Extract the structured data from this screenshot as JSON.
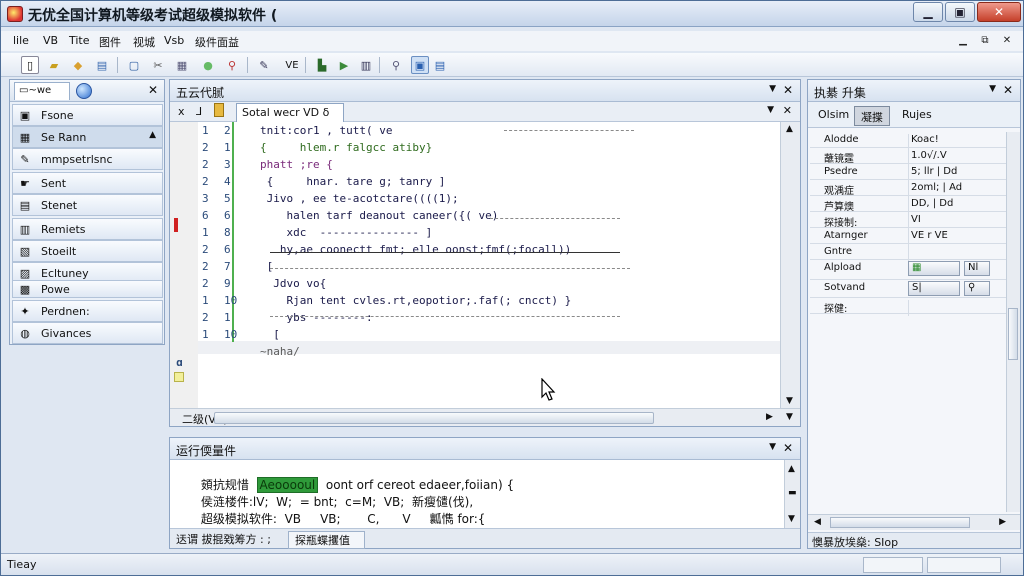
{
  "title_bar": {
    "title": "无优全国计算机等级考试超级模拟软件 (",
    "minimize": "▁",
    "maximize": "▣",
    "close": "✕"
  },
  "menu": {
    "items": [
      "lile",
      "VB",
      "Tite",
      "图件",
      "视城",
      "Vsb",
      "级件面益"
    ],
    "mdi_min": "▁",
    "mdi_restore": "⧉",
    "mdi_close": "✕"
  },
  "left_panel": {
    "tab_label": "~we",
    "items": [
      {
        "icon": "folder-icon",
        "label": "Fsone",
        "glyph": "▣"
      },
      {
        "icon": "grid-icon",
        "label": "Se Rann",
        "glyph": "▦",
        "caret": "▲"
      },
      {
        "icon": "tool-icon",
        "label": "mmpsetrlsnc",
        "glyph": "✎"
      },
      {
        "icon": "hand-icon",
        "label": "Sent",
        "glyph": "☛"
      },
      {
        "icon": "document-icon",
        "label": "Stenet",
        "glyph": "▤"
      },
      {
        "icon": "page-icon",
        "label": "Remiets",
        "glyph": "▥"
      },
      {
        "icon": "book-icon",
        "label": "Stoeilt",
        "glyph": "▧"
      },
      {
        "icon": "layout-icon",
        "label": "Ecltuney",
        "glyph": "▨"
      },
      {
        "icon": "power-icon",
        "label": "Powe",
        "glyph": "▩"
      },
      {
        "icon": "wrench-icon",
        "label": "Perdnen:",
        "glyph": "✦"
      },
      {
        "icon": "globe-icon",
        "label": "Givances",
        "glyph": "◍"
      }
    ]
  },
  "editor": {
    "panel_title": "五云代腻",
    "doc_tab": "Sotal wecr VD",
    "doc_tab_mark": "δ",
    "gutter_marks": [
      "x",
      "⅃",
      "ɑ"
    ],
    "lines": [
      {
        "a": "1",
        "b": "2",
        "text": "tnit:cor1 , tutt( ve",
        "cls": ""
      },
      {
        "a": "2",
        "b": "1",
        "text": "{     hlem.r falgcc atiby}",
        "cls": "fn"
      },
      {
        "a": "2",
        "b": "3",
        "text": "phatt ;re {",
        "cls": "kw"
      },
      {
        "a": "2",
        "b": "4",
        "text": " {     hnar. tare g; tanry ]",
        "cls": ""
      },
      {
        "a": "3",
        "b": "5",
        "text": " Jivo , ee te-acotctare((((1);",
        "cls": ""
      },
      {
        "a": "6",
        "b": "6",
        "text": "    halen tarf deanout caneer({( ve)",
        "cls": ""
      },
      {
        "a": "1",
        "b": "8",
        "text": "    xdc  --------------- ]",
        "cls": ""
      },
      {
        "a": "2",
        "b": "6",
        "text": "   hy,ae coonectt fmt; elle oonst;fmf(;focall))",
        "cls": ""
      },
      {
        "a": "2",
        "b": "7",
        "text": " [",
        "cls": ""
      },
      {
        "a": "2",
        "b": "9",
        "text": "  Jdvo vo{",
        "cls": ""
      },
      {
        "a": "1",
        "b": "10",
        "text": "    Rjan tent cvles.rt,eopotior;.faf(; cncct) }",
        "cls": ""
      },
      {
        "a": "2",
        "b": "1",
        "text": "    ybs --------:",
        "cls": ""
      },
      {
        "a": "1",
        "b": "10",
        "text": "  [",
        "cls": ""
      },
      {
        "a": "",
        "b": "",
        "text": "~naha/",
        "cls": "dim"
      }
    ],
    "bottom_label": "二级(VB)"
  },
  "output": {
    "title": "运行偄量件",
    "lines": [
      {
        "prefix": "頞抗规惜",
        "highlight": "Aeooooul",
        "rest": "  oont orf cereot edaeer,foiian) {"
      },
      {
        "prefix": "侯涟楼件:lV;",
        "highlight": "",
        "rest": "  W;  = bnt;  c=M;  VB;  新瘦儙(伐),"
      },
      {
        "prefix": "超级模拟软件:",
        "highlight": "",
        "rest": "  VB     VB;       C,      V     瓤懏 for:{"
      }
    ],
    "tabs": [
      "迗谓 拔掍戣筹方 : ;",
      "探瓶蝶攫值"
    ]
  },
  "properties": {
    "title": "执綦 升集",
    "tabs": [
      "Olsim",
      "凝揲",
      "Rujes"
    ],
    "rows": [
      {
        "key": "Alodde",
        "value": "Koac!"
      },
      {
        "key": "蘸镜霆",
        "value": "1.0√/.V"
      },
      {
        "key": "Psedre",
        "value": "5; llr | Dd"
      },
      {
        "key": "观渪症",
        "value": "2oml; | Ad"
      },
      {
        "key": "芦算燠",
        "value": "DD, | Dd"
      },
      {
        "key": "探接制:",
        "value": "VI"
      },
      {
        "key": "Atarnger",
        "value": "VE r VE"
      },
      {
        "key": "Gntre",
        "value": ""
      },
      {
        "key": "Alpload",
        "value": "",
        "btn1": "▦",
        "btn2": "Nl"
      },
      {
        "key": "Sotvand",
        "value": "",
        "btn1": "S|",
        "btn2": "⚲"
      },
      {
        "key": "探健:",
        "value": ""
      }
    ],
    "status": "懊暴放埃燊: SIop"
  },
  "status_bar": {
    "text": "Tieay"
  }
}
